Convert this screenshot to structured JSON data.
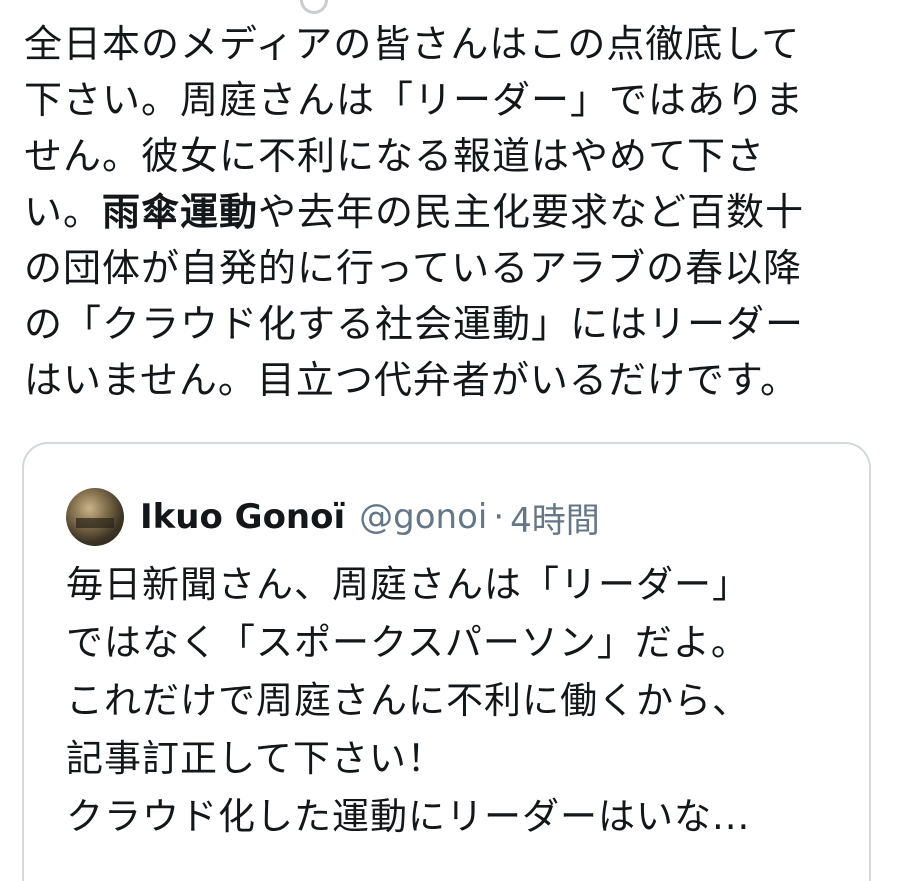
{
  "tweet": {
    "lines": [
      "全日本のメディアの皆さんはこの点徹底して",
      "下さい。周庭さんは「リーダー」ではありま",
      "せん。彼女に不利になる報道はやめて下さ",
      "い。",
      "や去年の民主化要求など百数十",
      "の団体が自発的に行っているアラブの春以降",
      "の「クラウド化する社会運動」にはリーダー",
      "はいません。目立つ代弁者がいるだけです。"
    ],
    "bold_phrase": "雨傘運動"
  },
  "quoted_tweet": {
    "author_name": "Ikuo Gonoï",
    "handle": "@gonoi",
    "separator": "·",
    "time": "4時間",
    "lines": [
      "毎日新聞さん、周庭さんは「リーダー」",
      "ではなく「スポークスパーソン」だよ。",
      "これだけで周庭さんに不利に働くから、",
      "記事訂正して下さい！",
      "クラウド化した運動にリーダーはいな..."
    ]
  }
}
